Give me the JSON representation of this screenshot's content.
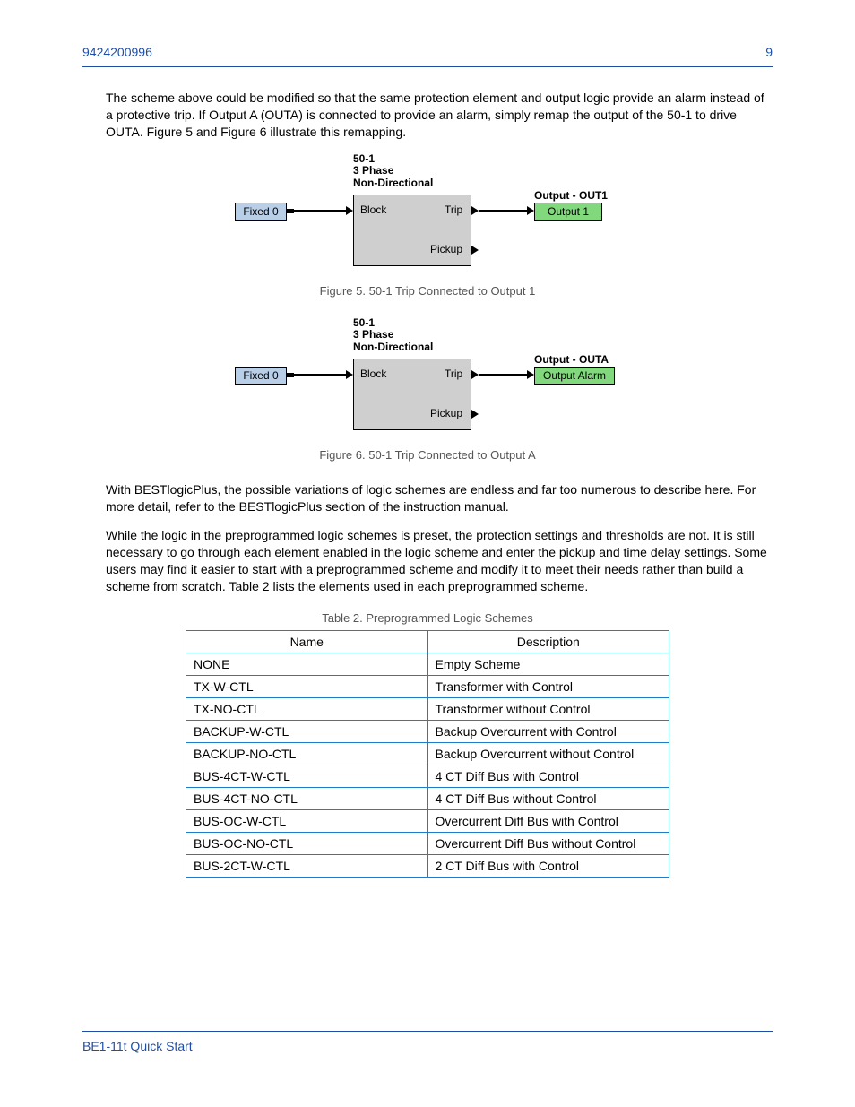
{
  "header": {
    "left": "9424200996",
    "right": "9"
  },
  "footer": {
    "left": "BE1-11t  Quick Start"
  },
  "intro": {
    "p1": "The scheme above could be modified so that the same protection element and output logic provide an alarm instead of a protective trip. If Output A (OUTA) is connected to provide an alarm, simply remap the output of the 50-1 to drive OUTA. Figure 5 and Figure 6 illustrate this remapping.",
    "fig5": "Figure 5. 50-1 Trip Connected to Output 1",
    "fig6": "Figure 6. 50-1 Trip Connected to Output A",
    "p2": "With BESTlogicPlus, the possible variations of logic schemes are endless and far too numerous to describe here. For more detail, refer to the BESTlogicPlus section of the instruction manual.",
    "p3": "While the logic in the preprogrammed logic schemes is preset, the protection settings and thresholds are not. It is still necessary to go through each element enabled in the logic scheme and enter the pickup and time delay settings. Some users may find it easier to start with a preprogrammed scheme and modify it to meet their needs rather than build a scheme from scratch. Table 2 lists the elements used in each preprogrammed scheme.",
    "tableTitle": "Table 2. Preprogrammed Logic Schemes"
  },
  "diagram": {
    "input": "Fixed 0",
    "func": {
      "title1": "50-1",
      "title2": "3 Phase",
      "title3": "Non-Directional",
      "portBlock": "Block",
      "portTrip": "Trip",
      "portPickup": "Pickup"
    },
    "out1": {
      "title": "Output - OUT1",
      "box": "Output 1"
    },
    "outA": {
      "title": "Output - OUTA",
      "box": "Output Alarm"
    }
  },
  "table": {
    "headers": [
      "Name",
      "Description"
    ],
    "rows": [
      [
        "NONE",
        "Empty Scheme"
      ],
      [
        "TX-W-CTL",
        "Transformer with Control"
      ],
      [
        "TX-NO-CTL",
        "Transformer without Control"
      ],
      [
        "BACKUP-W-CTL",
        "Backup Overcurrent with Control"
      ],
      [
        "BACKUP-NO-CTL",
        "Backup Overcurrent without Control"
      ],
      [
        "BUS-4CT-W-CTL",
        "4 CT Diff Bus with Control"
      ],
      [
        "BUS-4CT-NO-CTL",
        "4 CT Diff Bus without Control"
      ],
      [
        "BUS-OC-W-CTL",
        "Overcurrent Diff Bus with Control"
      ],
      [
        "BUS-OC-NO-CTL",
        "Overcurrent Diff Bus without Control"
      ],
      [
        "BUS-2CT-W-CTL",
        "2 CT Diff Bus with Control"
      ]
    ]
  }
}
